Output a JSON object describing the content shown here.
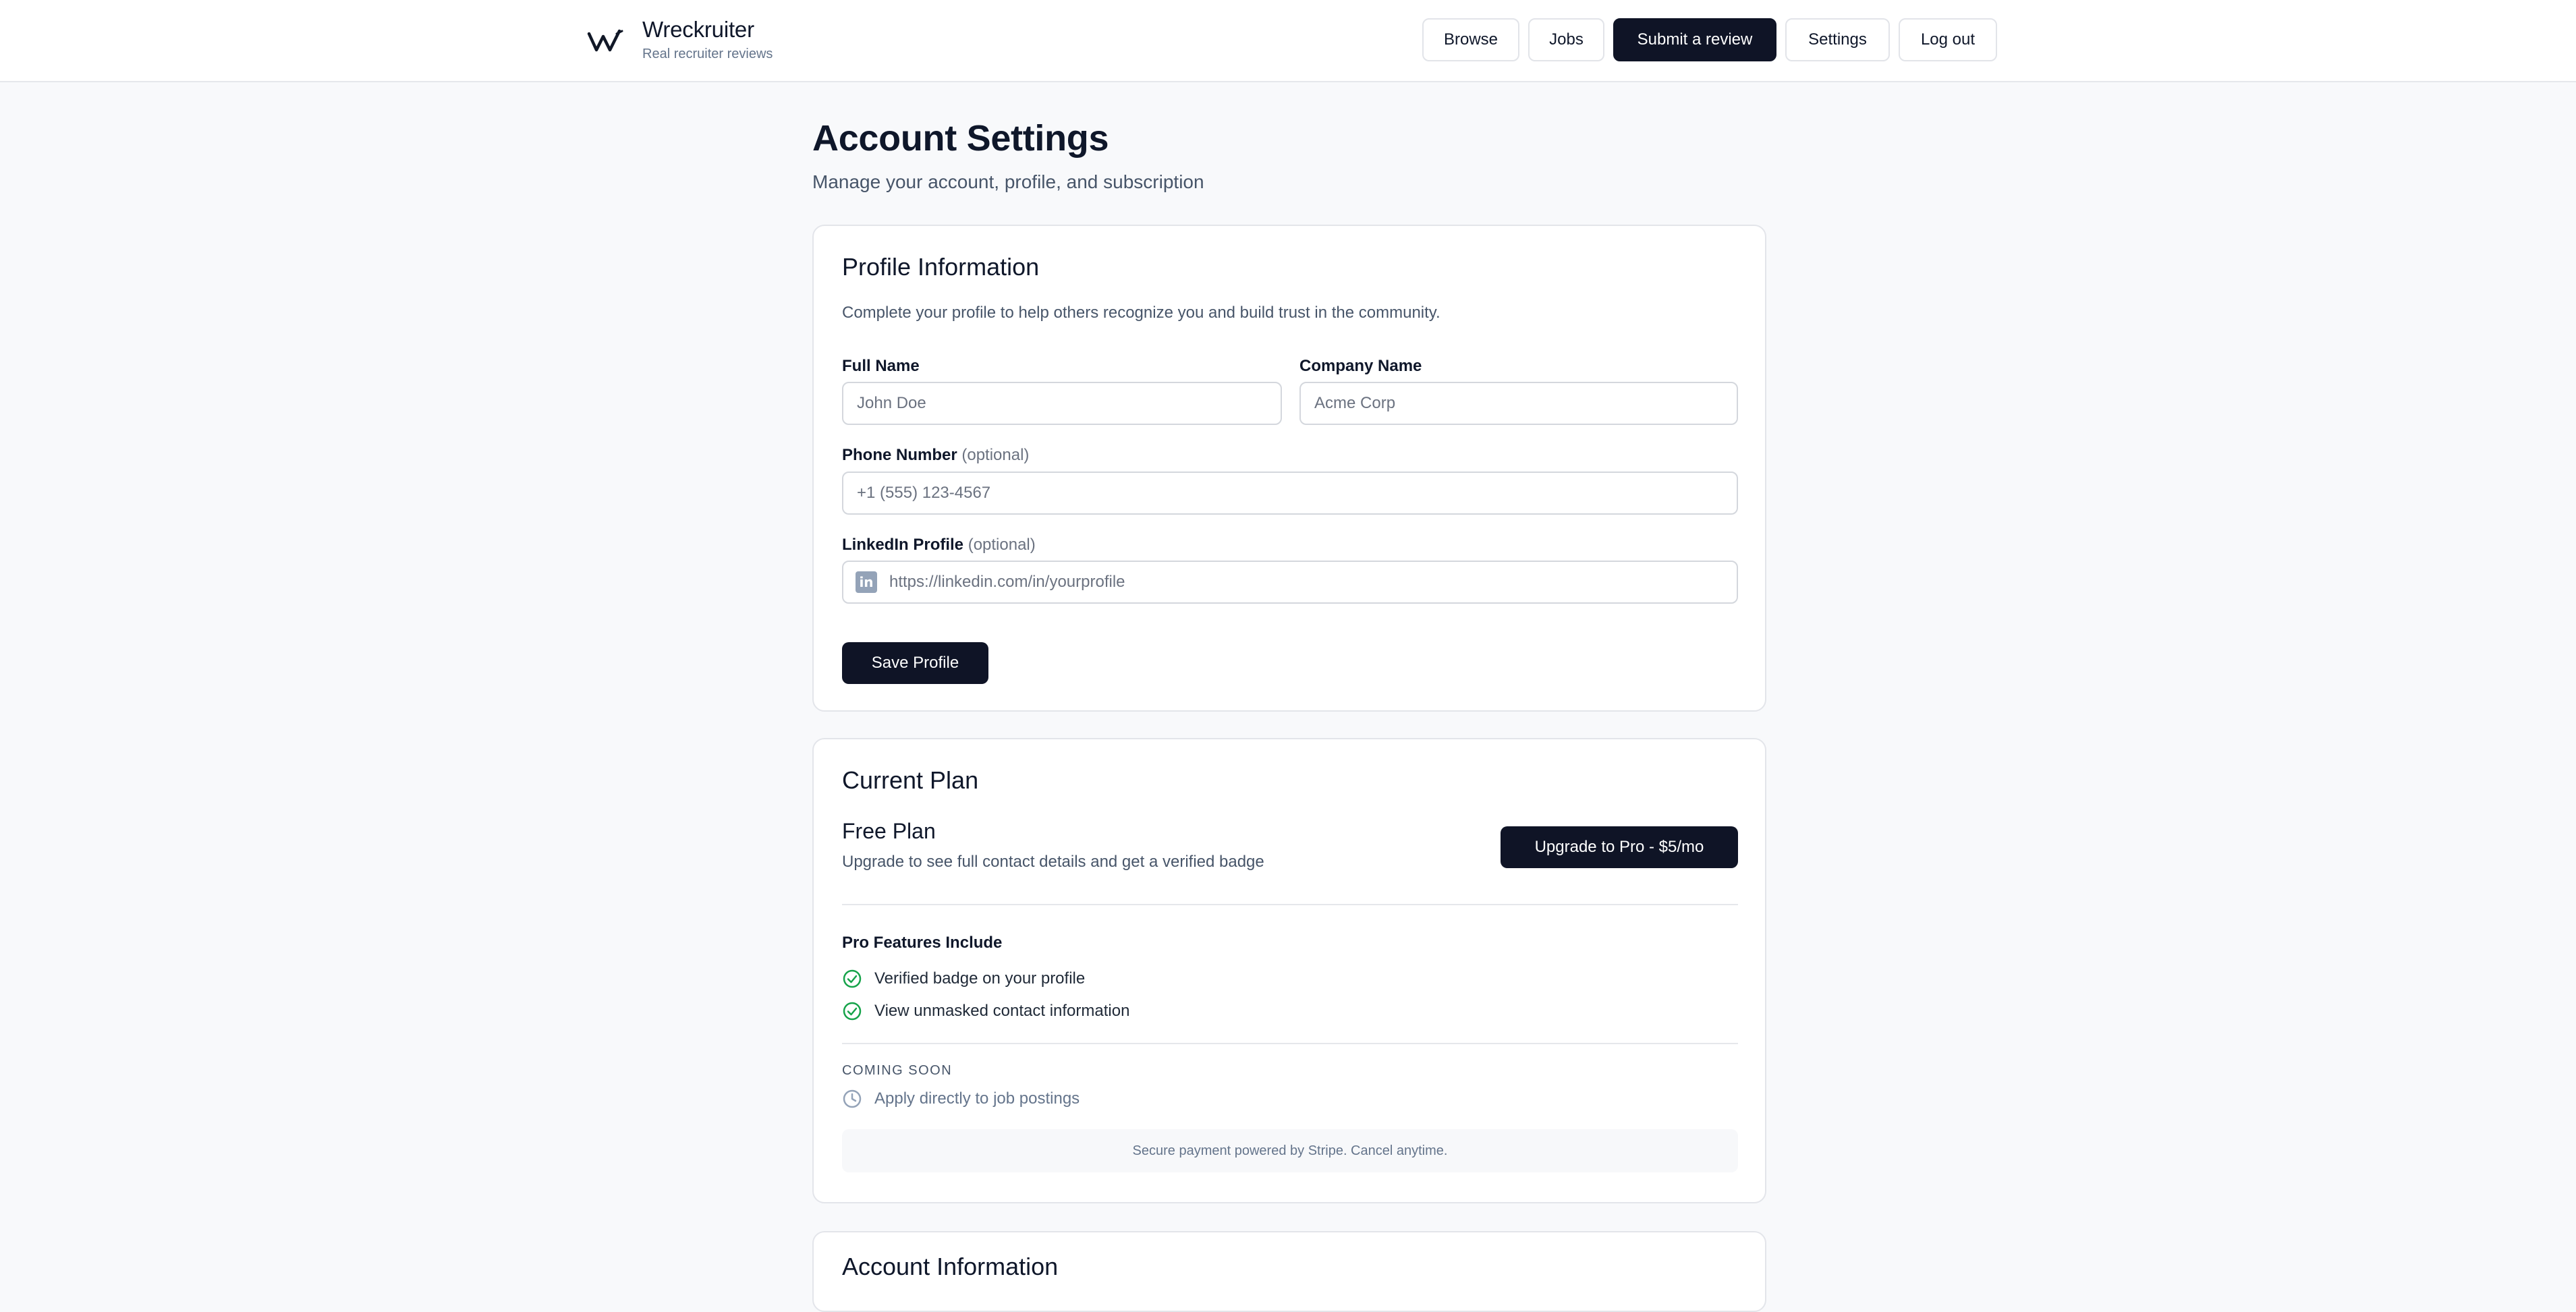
{
  "brand": {
    "name": "Wreckruiter",
    "tagline": "Real recruiter reviews",
    "logo_icon": "w-logo-icon"
  },
  "nav": {
    "browse": "Browse",
    "jobs": "Jobs",
    "submit_review": "Submit a review",
    "settings": "Settings",
    "logout": "Log out"
  },
  "page": {
    "title": "Account Settings",
    "subtitle": "Manage your account, profile, and subscription"
  },
  "profile": {
    "title": "Profile Information",
    "description": "Complete your profile to help others recognize you and build trust in the community.",
    "full_name": {
      "label": "Full Name",
      "placeholder": "John Doe"
    },
    "company": {
      "label": "Company Name",
      "placeholder": "Acme Corp"
    },
    "phone": {
      "label": "Phone Number",
      "optional": "(optional)",
      "placeholder": "+1 (555) 123-4567"
    },
    "linkedin": {
      "label": "LinkedIn Profile",
      "optional": "(optional)",
      "placeholder": "https://linkedin.com/in/yourprofile",
      "icon_text": "in"
    },
    "save_label": "Save Profile"
  },
  "plan": {
    "title": "Current Plan",
    "name": "Free Plan",
    "description": "Upgrade to see full contact details and get a verified badge",
    "upgrade_label": "Upgrade to Pro - $5/mo",
    "features_title": "Pro Features Include",
    "features": [
      "Verified badge on your profile",
      "View unmasked contact information"
    ],
    "coming_soon_label": "COMING SOON",
    "coming_soon_items": [
      "Apply directly to job postings"
    ],
    "payment_note": "Secure payment powered by Stripe. Cancel anytime."
  },
  "account": {
    "title": "Account Information"
  },
  "colors": {
    "primary": "#0f1426",
    "success": "#16a34a",
    "muted": "#94a3b8",
    "background": "#f8f9fb"
  }
}
